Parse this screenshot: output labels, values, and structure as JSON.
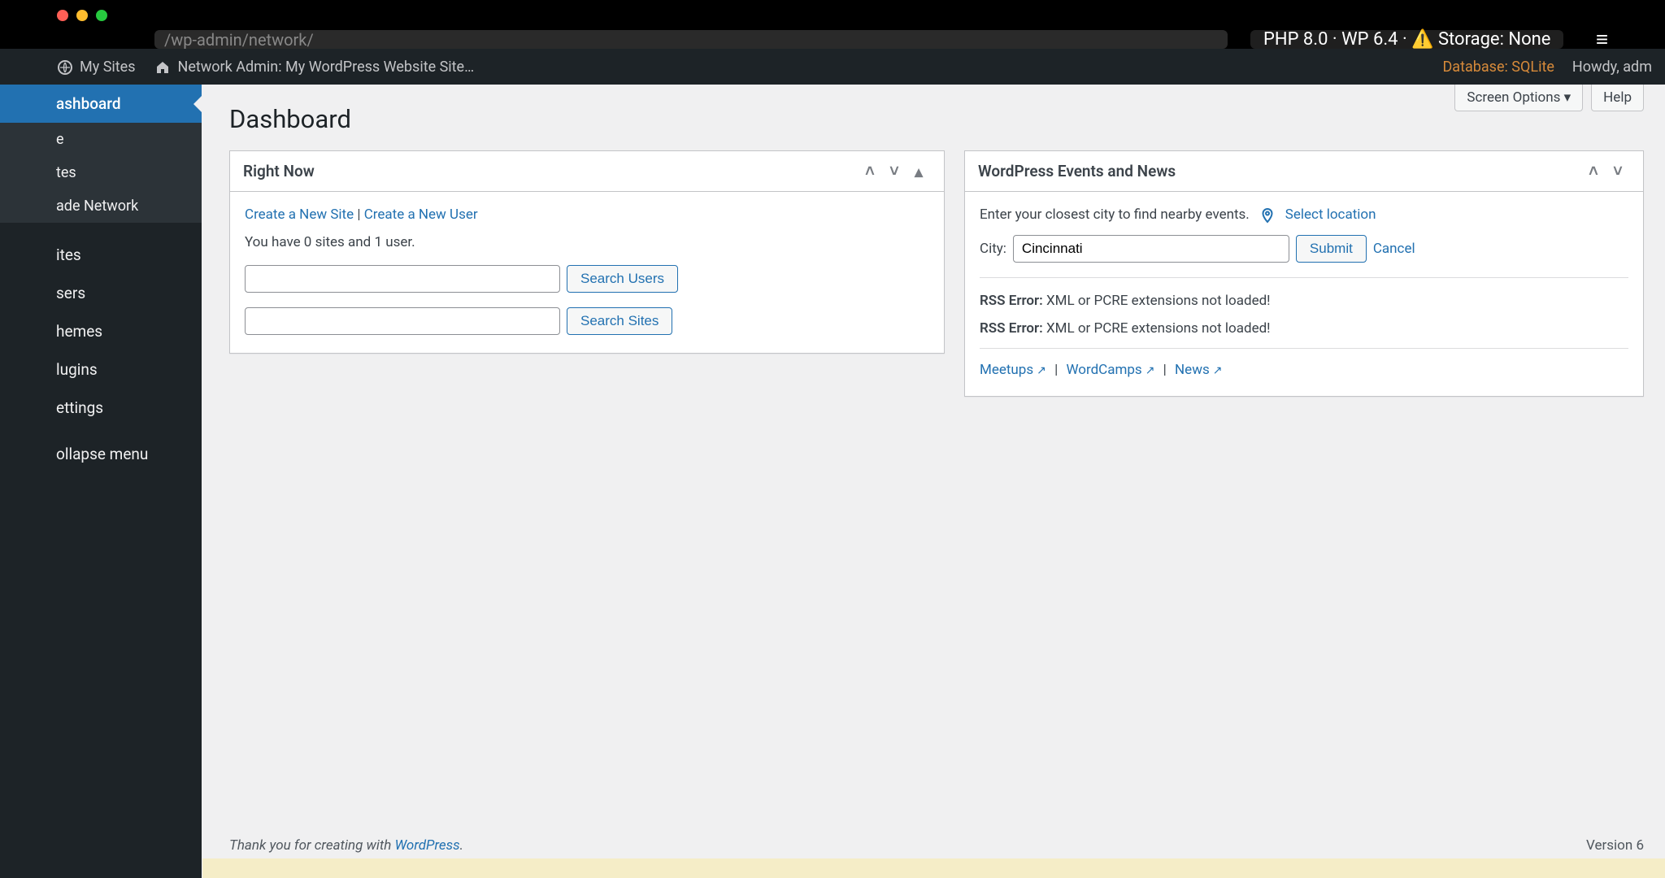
{
  "os": {
    "url": "/wp-admin/network/",
    "status_pill": "PHP 8.0 · WP 6.4 · ⚠️ Storage: None"
  },
  "adminbar": {
    "mysites": "My Sites",
    "network_admin": "Network Admin: My WordPress Website Site…",
    "database": "Database: SQLite",
    "howdy": "Howdy, adm"
  },
  "sidebar": {
    "dashboard": "ashboard",
    "home": "e",
    "sites_sub": "tes",
    "upgrade": "ade Network",
    "sites": "ites",
    "users": "sers",
    "themes": "hemes",
    "plugins": "lugins",
    "settings": "ettings",
    "collapse": "ollapse menu"
  },
  "screen_tabs": {
    "screen_options": "Screen Options ▾",
    "help": "Help"
  },
  "page_title": "Dashboard",
  "right_now": {
    "title": "Right Now",
    "create_site": "Create a New Site",
    "separator": "|",
    "create_user": "Create a New User",
    "stats": "You have 0 sites and 1 user.",
    "search_users_btn": "Search Users",
    "search_sites_btn": "Search Sites"
  },
  "events": {
    "title": "WordPress Events and News",
    "intro": "Enter your closest city to find nearby events.",
    "select_location": "Select location",
    "city_label": "City:",
    "city_value": "Cincinnati",
    "submit": "Submit",
    "cancel": "Cancel",
    "rss_error_label": "RSS Error:",
    "rss_error_msg": "XML or PCRE extensions not loaded!",
    "meetups": "Meetups",
    "wordcamps": "WordCamps",
    "news": "News"
  },
  "footer": {
    "thanks": "Thank you for creating with ",
    "wp_link": "WordPress",
    "period": ".",
    "version": "Version 6"
  }
}
